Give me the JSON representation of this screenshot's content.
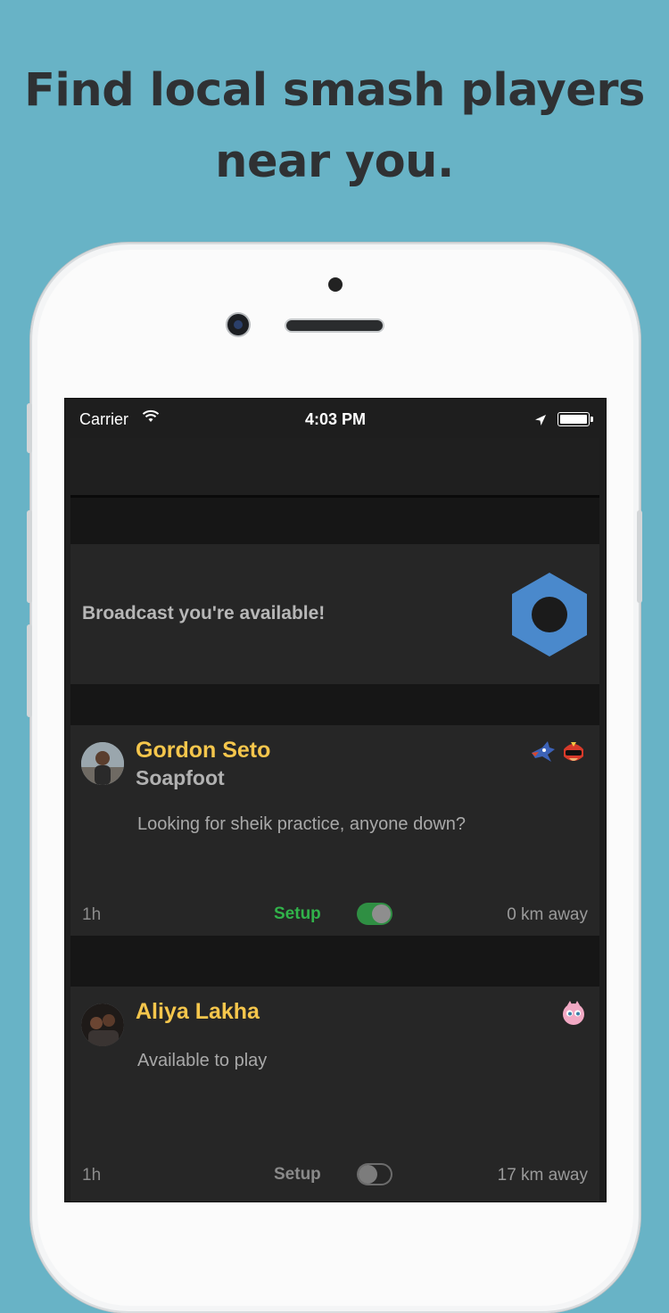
{
  "headline": {
    "line1": "Find local smash players",
    "line2": "near you."
  },
  "status_bar": {
    "carrier": "Carrier",
    "time": "4:03 PM",
    "wifi_icon": "wifi-icon",
    "location_icon": "location-arrow-icon",
    "battery_icon": "battery-icon"
  },
  "broadcast": {
    "label": "Broadcast you're available!",
    "icon": "hexagon-toggle-icon",
    "icon_color": "#4a89cc"
  },
  "posts": [
    {
      "name": "Gordon Seto",
      "tag": "Soapfoot",
      "message": "Looking for sheik practice, anyone down?",
      "time": "1h",
      "setup_label": "Setup",
      "setup_on": true,
      "distance": "0 km away",
      "characters": [
        "falco-icon",
        "captain-falcon-icon"
      ]
    },
    {
      "name": "Aliya Lakha",
      "tag": "",
      "message": "Available to play",
      "time": "1h",
      "setup_label": "Setup",
      "setup_on": false,
      "distance": "17 km away",
      "characters": [
        "jigglypuff-icon"
      ]
    }
  ],
  "colors": {
    "background": "#68b3c6",
    "name": "#f5c64c",
    "setup_on": "#31b24a",
    "card": "#262626"
  }
}
